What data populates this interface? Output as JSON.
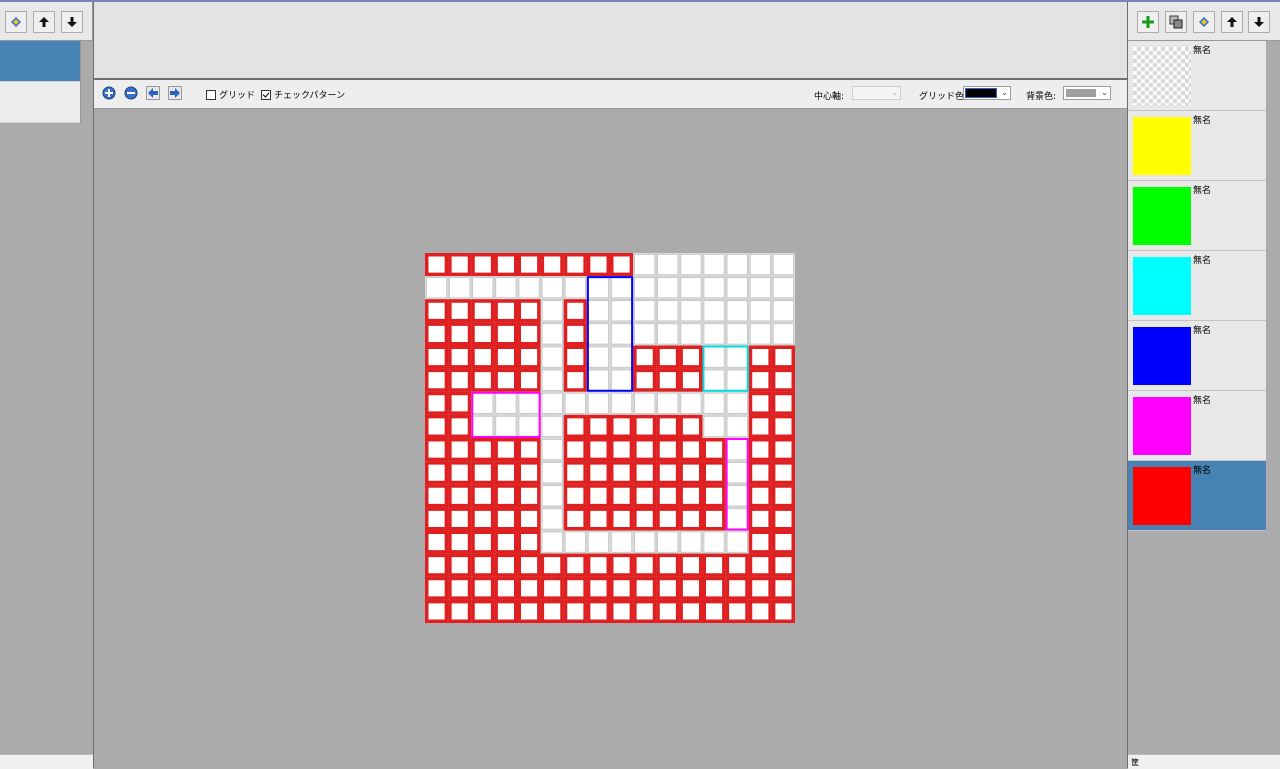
{
  "left_panel": {
    "toolbar": [
      {
        "name": "merge-layer-icon"
      },
      {
        "name": "up-arrow-icon"
      },
      {
        "name": "down-arrow-icon"
      }
    ],
    "items_count_visible": 2,
    "selected_index": 0
  },
  "toolbar": {
    "buttons": [
      {
        "name": "zoom-in-icon"
      },
      {
        "name": "zoom-out-icon"
      },
      {
        "name": "left-arrow-icon"
      },
      {
        "name": "right-arrow-icon"
      }
    ],
    "grid_label": "グリッド",
    "grid_checked": false,
    "check_pattern_label": "チェックパターン",
    "check_pattern_checked": true,
    "center_axis_label": "中心軸:",
    "grid_color_label": "グリッド色:",
    "grid_color": "#000000",
    "bg_color_label": "背景色:",
    "bg_color": "#a0a0a0"
  },
  "layers_toolbar": [
    {
      "name": "add-layer-icon"
    },
    {
      "name": "duplicate-layer-icon"
    },
    {
      "name": "merge-layer-icon"
    },
    {
      "name": "up-arrow-icon"
    },
    {
      "name": "down-arrow-icon"
    }
  ],
  "layers": [
    {
      "name": "無名",
      "color": "checker",
      "selected": false
    },
    {
      "name": "無名",
      "color": "#ffff00",
      "selected": false
    },
    {
      "name": "無名",
      "color": "#00ff00",
      "selected": false
    },
    {
      "name": "無名",
      "color": "#00ffff",
      "selected": false
    },
    {
      "name": "無名",
      "color": "#0000ff",
      "selected": false
    },
    {
      "name": "無名",
      "color": "#ff00ff",
      "selected": false
    },
    {
      "name": "無名",
      "color": "#ff0000",
      "selected": true
    }
  ],
  "status": {
    "right_text": "筐"
  },
  "canvas": {
    "cols": 16,
    "rows": 16,
    "fill_color": "#e02020",
    "empty_color": "#ffffff",
    "white_cells": [
      [
        0,
        9
      ],
      [
        0,
        10
      ],
      [
        0,
        11
      ],
      [
        0,
        12
      ],
      [
        0,
        13
      ],
      [
        0,
        14
      ],
      [
        0,
        15
      ],
      [
        1,
        0
      ],
      [
        1,
        1
      ],
      [
        1,
        2
      ],
      [
        1,
        3
      ],
      [
        1,
        4
      ],
      [
        1,
        5
      ],
      [
        1,
        6
      ],
      [
        1,
        7
      ],
      [
        1,
        8
      ],
      [
        1,
        9
      ],
      [
        1,
        10
      ],
      [
        1,
        11
      ],
      [
        1,
        12
      ],
      [
        1,
        13
      ],
      [
        1,
        14
      ],
      [
        1,
        15
      ],
      [
        2,
        5
      ],
      [
        2,
        7
      ],
      [
        2,
        8
      ],
      [
        2,
        9
      ],
      [
        2,
        10
      ],
      [
        2,
        11
      ],
      [
        2,
        12
      ],
      [
        2,
        13
      ],
      [
        2,
        14
      ],
      [
        2,
        15
      ],
      [
        3,
        5
      ],
      [
        3,
        7
      ],
      [
        3,
        8
      ],
      [
        3,
        9
      ],
      [
        3,
        10
      ],
      [
        3,
        11
      ],
      [
        3,
        12
      ],
      [
        3,
        13
      ],
      [
        3,
        14
      ],
      [
        3,
        15
      ],
      [
        4,
        5
      ],
      [
        4,
        7
      ],
      [
        4,
        8
      ],
      [
        4,
        12
      ],
      [
        4,
        13
      ],
      [
        5,
        5
      ],
      [
        5,
        7
      ],
      [
        5,
        8
      ],
      [
        5,
        12
      ],
      [
        5,
        13
      ],
      [
        6,
        2
      ],
      [
        6,
        3
      ],
      [
        6,
        4
      ],
      [
        6,
        5
      ],
      [
        6,
        6
      ],
      [
        6,
        7
      ],
      [
        6,
        8
      ],
      [
        6,
        9
      ],
      [
        6,
        10
      ],
      [
        6,
        11
      ],
      [
        6,
        12
      ],
      [
        6,
        13
      ],
      [
        7,
        2
      ],
      [
        7,
        3
      ],
      [
        7,
        4
      ],
      [
        7,
        5
      ],
      [
        7,
        12
      ],
      [
        7,
        13
      ],
      [
        8,
        5
      ],
      [
        8,
        13
      ],
      [
        9,
        5
      ],
      [
        9,
        13
      ],
      [
        10,
        5
      ],
      [
        10,
        13
      ],
      [
        11,
        5
      ],
      [
        11,
        13
      ],
      [
        12,
        5
      ],
      [
        12,
        6
      ],
      [
        12,
        7
      ],
      [
        12,
        8
      ],
      [
        12,
        9
      ],
      [
        12,
        10
      ],
      [
        12,
        11
      ],
      [
        12,
        12
      ],
      [
        12,
        13
      ]
    ],
    "outlines": [
      {
        "color": "#0000ff",
        "row": 1,
        "col": 7,
        "rows": 5,
        "cols": 2
      },
      {
        "color": "#00e0e0",
        "row": 4,
        "col": 12,
        "rows": 2,
        "cols": 2
      },
      {
        "color": "#ff00ff",
        "row": 6,
        "col": 2,
        "rows": 2,
        "cols": 3
      },
      {
        "color": "#ff00ff",
        "row": 8,
        "col": 13,
        "rows": 4,
        "cols": 1
      }
    ]
  }
}
